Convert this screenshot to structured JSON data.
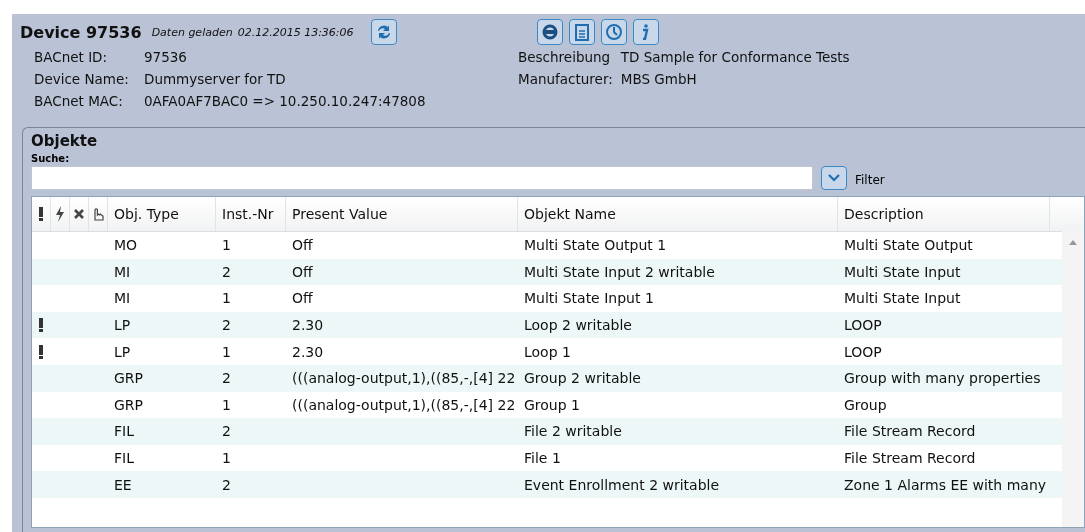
{
  "device": {
    "title": "Device 97536",
    "loaded_label": "Daten geladen",
    "loaded_time": "02.12.2015 13:36:06"
  },
  "info_left": [
    {
      "label": "BACnet ID:",
      "value": "97536"
    },
    {
      "label": "Device Name:",
      "value": "Dummyserver for TD"
    },
    {
      "label": "BACnet MAC:",
      "value": "0AFA0AF7BAC0 => 10.250.10.247:47808"
    }
  ],
  "info_right": [
    {
      "label": "Beschreibung",
      "value": "TD Sample for Conformance Tests"
    },
    {
      "label": "Manufacturer:",
      "value": "MBS GmbH"
    }
  ],
  "objects": {
    "title": "Objekte",
    "search_label": "Suche:",
    "filter_label": "Filter",
    "columns": [
      "Obj. Type",
      "Inst.-Nr",
      "Present Value",
      "Objekt Name",
      "Description"
    ],
    "rows": [
      {
        "alarm": false,
        "type": "MO",
        "inst": "1",
        "value": "Off",
        "name": "Multi State Output 1",
        "description": "Multi State Output"
      },
      {
        "alarm": false,
        "type": "MI",
        "inst": "2",
        "value": "Off",
        "name": "Multi State Input 2 writable",
        "description": "Multi State Input"
      },
      {
        "alarm": false,
        "type": "MI",
        "inst": "1",
        "value": "Off",
        "name": "Multi State Input 1",
        "description": "Multi State Input"
      },
      {
        "alarm": true,
        "type": "LP",
        "inst": "2",
        "value": "2.30",
        "name": "Loop 2 writable",
        "description": "LOOP"
      },
      {
        "alarm": true,
        "type": "LP",
        "inst": "1",
        "value": "2.30",
        "name": "Loop 1",
        "description": "LOOP"
      },
      {
        "alarm": false,
        "type": "GRP",
        "inst": "2",
        "value": "(((analog-output,1),((85,-,[4] 22",
        "name": "Group 2 writable",
        "description": "Group with many properties"
      },
      {
        "alarm": false,
        "type": "GRP",
        "inst": "1",
        "value": "(((analog-output,1),((85,-,[4] 22",
        "name": "Group 1",
        "description": "Group"
      },
      {
        "alarm": false,
        "type": "FIL",
        "inst": "2",
        "value": "",
        "name": "File 2 writable",
        "description": "File Stream Record"
      },
      {
        "alarm": false,
        "type": "FIL",
        "inst": "1",
        "value": "",
        "name": "File 1",
        "description": "File Stream Record"
      },
      {
        "alarm": false,
        "type": "EE",
        "inst": "2",
        "value": "",
        "name": "Event Enrollment 2 writable",
        "description": "Zone 1 Alarms EE with many"
      }
    ]
  }
}
